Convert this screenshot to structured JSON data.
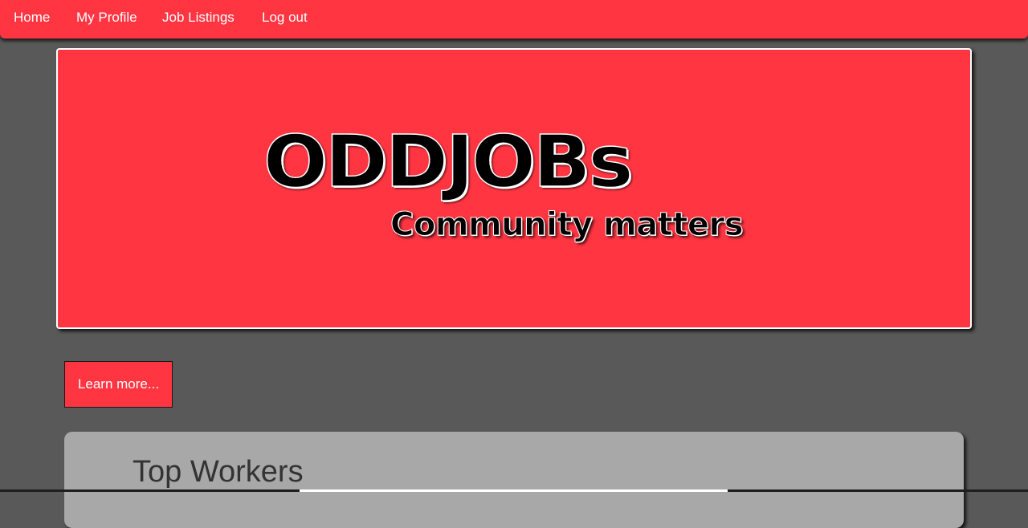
{
  "nav": {
    "items": [
      {
        "label": "Home"
      },
      {
        "label": "My Profile"
      },
      {
        "label": "Job Listings"
      },
      {
        "label": "Log out"
      }
    ]
  },
  "banner": {
    "logo_text": "ODDJOBs",
    "tagline": "Community matters"
  },
  "learn_more_button": {
    "label": "Learn more..."
  },
  "top_workers": {
    "heading": "Top Workers"
  },
  "colors": {
    "brand_red": "#ff3542",
    "page_background": "#595959",
    "panel_gray": "#a8a8a8"
  }
}
